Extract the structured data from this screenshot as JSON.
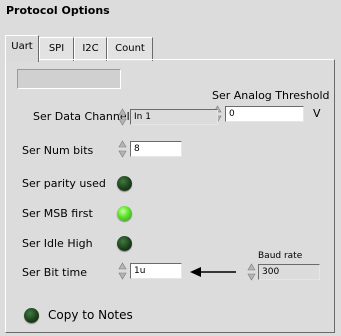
{
  "panel": {
    "title": "Protocol Options"
  },
  "tabs": [
    {
      "label": "Uart",
      "active": true
    },
    {
      "label": "SPI",
      "active": false
    },
    {
      "label": "I2C",
      "active": false
    },
    {
      "label": "Count",
      "active": false
    }
  ],
  "uart": {
    "analog_threshold": {
      "label": "Ser Analog Threshold",
      "value": "0",
      "unit": "V"
    },
    "data_channel": {
      "label": "Ser Data Channel",
      "value": "In 1"
    },
    "num_bits": {
      "label": "Ser Num bits",
      "value": "8"
    },
    "parity_used": {
      "label": "Ser parity used",
      "state": "off"
    },
    "msb_first": {
      "label": "Ser MSB first",
      "state": "on"
    },
    "idle_high": {
      "label": "Ser Idle High",
      "state": "off"
    },
    "bit_time": {
      "label": "Ser Bit time",
      "value": "1u"
    },
    "baud_rate": {
      "label": "Baud rate",
      "value": "300"
    },
    "copy_to_notes": {
      "label": "Copy to Notes",
      "state": "off"
    }
  },
  "colors": {
    "panel_bg": "#dcdcdc",
    "led_on": "#59e12a",
    "led_off": "#1d401d"
  },
  "icons": {
    "stepper": "up-down-stepper-icon",
    "arrow": "arrow-left-icon"
  }
}
